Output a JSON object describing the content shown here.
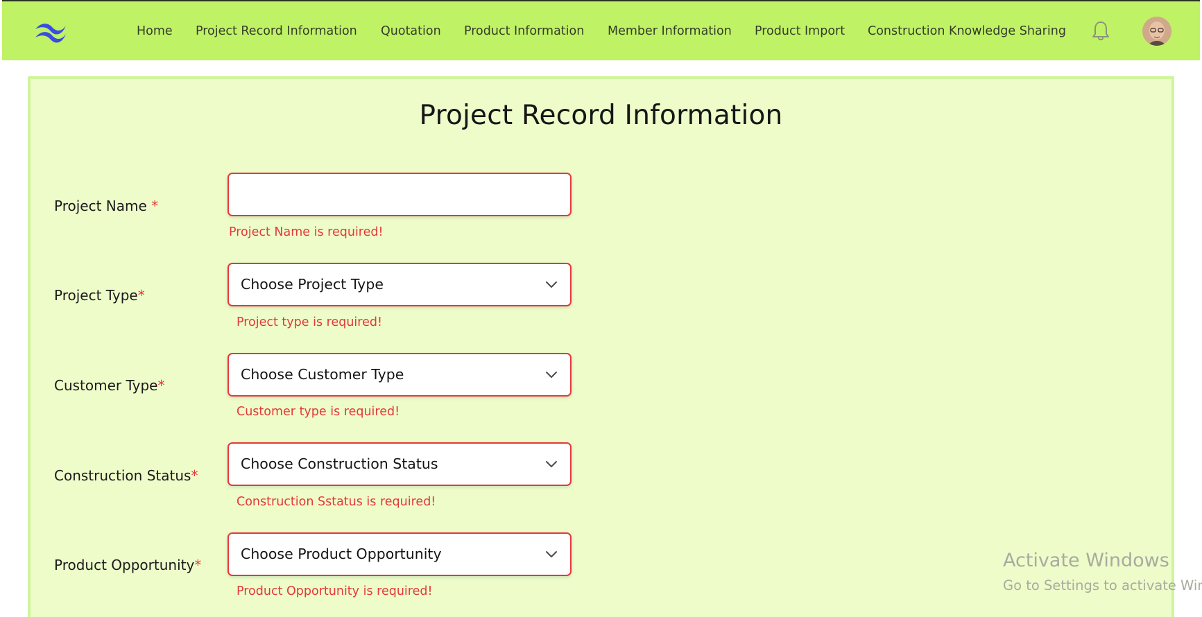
{
  "nav": {
    "items": [
      {
        "label": "Home"
      },
      {
        "label": "Project Record Information"
      },
      {
        "label": "Quotation"
      },
      {
        "label": "Product Information"
      },
      {
        "label": "Member Information"
      },
      {
        "label": "Product Import"
      },
      {
        "label": "Construction Knowledge Sharing"
      }
    ],
    "logo_icon": "tailwind-logo-icon",
    "bell_icon": "bell-icon",
    "avatar_icon": "user-avatar"
  },
  "page": {
    "title": "Project Record Information"
  },
  "form": {
    "fields": [
      {
        "label": "Project Name ",
        "required_mark": "*",
        "value": "",
        "error": "Project Name is required!"
      },
      {
        "label": "Project Type",
        "required_mark": "*",
        "value": "Choose Project Type",
        "error": "Project type is required!"
      },
      {
        "label": "Customer Type",
        "required_mark": "*",
        "value": "Choose Customer Type",
        "error": "Customer type is required!"
      },
      {
        "label": "Construction Status",
        "required_mark": "*",
        "value": "Choose Construction Status",
        "error": "Construction Sstatus is required!"
      },
      {
        "label": "Product Opportunity",
        "required_mark": "*",
        "value": "Choose Product Opportunity",
        "error": "Product Opportunity is required!"
      }
    ]
  },
  "watermark": {
    "title": "Activate Windows",
    "subtitle": "Go to Settings to activate Win"
  },
  "colors": {
    "nav_bg": "#c0f266",
    "card_bg": "#eefcca",
    "error": "#e4383a",
    "accent": "#3b4de0"
  }
}
